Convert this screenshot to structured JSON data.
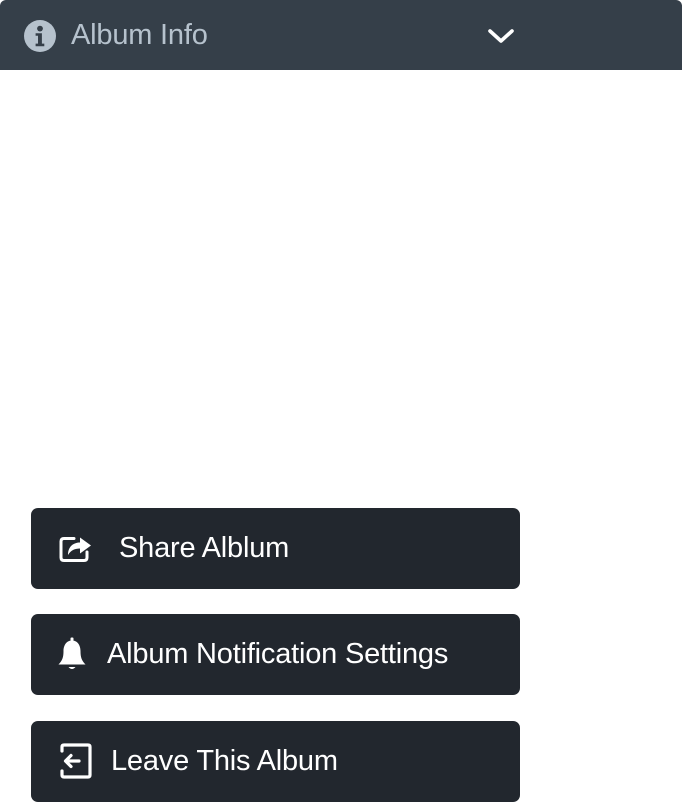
{
  "header": {
    "title": "Album Info",
    "icon": "info-icon",
    "toggle_icon": "chevron-down-icon",
    "background": "#353f49",
    "text_color": "#b6c2cd"
  },
  "actions": [
    {
      "label": "Share Alblum",
      "icon": "share-icon"
    },
    {
      "label": "Album Notification Settings",
      "icon": "bell-icon"
    },
    {
      "label": "Leave This Album",
      "icon": "leave-icon"
    }
  ],
  "colors": {
    "button_background": "#22272e",
    "button_text": "#ffffff",
    "page_background": "#ffffff"
  }
}
